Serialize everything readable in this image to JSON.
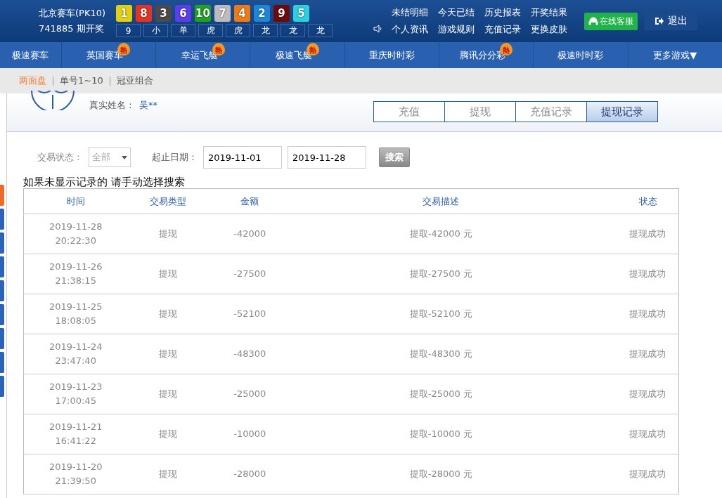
{
  "header": {
    "game": "北京赛车(PK10)",
    "period": "741885 期开奖",
    "balls": [
      {
        "number": "1",
        "color": "#e2d00c"
      },
      {
        "number": "8",
        "color": "#e8321e"
      },
      {
        "number": "3",
        "color": "#4a4a4a"
      },
      {
        "number": "6",
        "color": "#5b3ee8"
      },
      {
        "number": "10",
        "color": "#1aa51a"
      },
      {
        "number": "7",
        "color": "#bcbcbc"
      },
      {
        "number": "4",
        "color": "#f07a10"
      },
      {
        "number": "2",
        "color": "#1a88d6"
      },
      {
        "number": "9",
        "color": "#6e0a0a"
      },
      {
        "number": "5",
        "color": "#2ad0e0"
      }
    ],
    "results": [
      "9",
      "小",
      "单",
      "虎",
      "虎",
      "龙",
      "龙",
      "龙"
    ],
    "links": [
      "未结明细",
      "今天已结",
      "历史报表",
      "开奖结果",
      "个人资讯",
      "游戏规则",
      "充值记录",
      "更换皮肤"
    ],
    "service": "在线客服",
    "logout": "退出"
  },
  "nav": [
    {
      "label": "极速赛车"
    },
    {
      "label": "英国赛车",
      "badge": "熱"
    },
    {
      "label": "幸运飞艇",
      "badge": "熱"
    },
    {
      "label": "极速飞艇",
      "badge": "熱"
    },
    {
      "label": "重庆时时彩"
    },
    {
      "label": "腾讯分分彩",
      "badge": "熱"
    },
    {
      "label": "极速时时彩"
    },
    {
      "label": "更多游戏",
      "caret": "▼"
    }
  ],
  "breadcrumb": [
    {
      "label": "两面盘",
      "selected": true
    },
    {
      "label": "单号1~10",
      "selected": false
    },
    {
      "label": "冠亚组合",
      "selected": false
    }
  ],
  "side_tabs": [
    {
      "selected": true
    },
    {
      "selected": false
    },
    {
      "selected": false
    },
    {
      "selected": false
    },
    {
      "selected": false
    },
    {
      "selected": false
    },
    {
      "selected": false
    },
    {
      "selected": false
    },
    {
      "selected": false
    }
  ],
  "user": {
    "label": "真实姓名：",
    "name": "吴**"
  },
  "tabs": [
    {
      "label": "充值",
      "selected": false
    },
    {
      "label": "提现",
      "selected": false
    },
    {
      "label": "充值记录",
      "selected": false
    },
    {
      "label": "提现记录",
      "selected": true
    }
  ],
  "filter": {
    "status_label": "交易状态：",
    "status_value": "全部",
    "date_label": "起止日期：",
    "start": "2019-11-01",
    "end": "2019-11-28",
    "search": "搜索"
  },
  "note": "如果未显示记录的 请手动选择搜索",
  "table": {
    "columns": [
      "时间",
      "交易类型",
      "金额",
      "交易描述",
      "状态"
    ],
    "rows": [
      [
        "2019-11-28\n20:22:30",
        "提现",
        "-42000",
        "提取-42000 元",
        "提现成功"
      ],
      [
        "2019-11-26\n21:38:15",
        "提现",
        "-27500",
        "提取-27500 元",
        "提现成功"
      ],
      [
        "2019-11-25\n18:08:05",
        "提现",
        "-52100",
        "提取-52100 元",
        "提现成功"
      ],
      [
        "2019-11-24\n23:47:40",
        "提现",
        "-48300",
        "提取-48300 元",
        "提现成功"
      ],
      [
        "2019-11-23\n17:00:45",
        "提现",
        "-25000",
        "提取-25000 元",
        "提现成功"
      ],
      [
        "2019-11-21\n16:41:22",
        "提现",
        "-10000",
        "提取-10000 元",
        "提现成功"
      ],
      [
        "2019-11-20\n21:39:50",
        "提现",
        "-28000",
        "提取-28000 元",
        "提现成功"
      ]
    ]
  }
}
